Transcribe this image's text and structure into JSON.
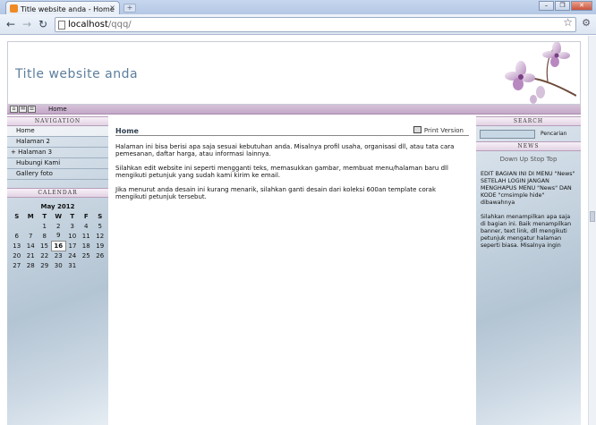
{
  "browser": {
    "tab_title": "Title website anda - Home",
    "tab_close": "×",
    "new_tab": "+",
    "url_host": "localhost",
    "url_path": "/qqq/",
    "icons": [
      "back-icon",
      "forward-icon",
      "reload-icon",
      "star-icon",
      "wrench-icon"
    ]
  },
  "site": {
    "title": "Title website anda",
    "breadcrumb": "Home"
  },
  "navigation": {
    "heading": "NAVIGATION",
    "items": [
      {
        "label": "Home"
      },
      {
        "label": "Halaman 2"
      },
      {
        "label": "+ Halaman 3"
      },
      {
        "label": "Hubungi Kami"
      },
      {
        "label": "Gallery foto"
      }
    ]
  },
  "calendar": {
    "heading": "CALENDAR",
    "month": "May 2012",
    "weekdays": [
      "S",
      "M",
      "T",
      "W",
      "T",
      "F",
      "S"
    ],
    "weeks": [
      [
        "",
        "",
        "1",
        "2",
        "3",
        "4",
        "5"
      ],
      [
        "6",
        "7",
        "8",
        "9",
        "10",
        "11",
        "12"
      ],
      [
        "13",
        "14",
        "15",
        "16",
        "17",
        "18",
        "19"
      ],
      [
        "20",
        "21",
        "22",
        "23",
        "24",
        "25",
        "26"
      ],
      [
        "27",
        "28",
        "29",
        "30",
        "31",
        "",
        ""
      ]
    ],
    "today": "16"
  },
  "main": {
    "title": "Home",
    "print_label": "Print Version",
    "paragraphs": [
      "Halaman ini bisa berisi apa saja sesuai kebutuhan anda. Misalnya profil usaha, organisasi dll, atau tata cara pemesanan, daftar harga, atau informasi lainnya.",
      "Silahkan edit website ini seperti mengganti teks, memasukkan gambar, membuat menu/halaman baru dll mengikuti petunjuk yang sudah kami kirim ke email.",
      "Jika menurut anda desain ini kurang menarik, silahkan ganti desain dari koleksi 600an template corak mengikuti petunjuk tersebut."
    ]
  },
  "search": {
    "heading": "SEARCH",
    "button": "Pencarian",
    "placeholder": ""
  },
  "news": {
    "heading": "NEWS",
    "ticker": "Down Up Stop Top",
    "paragraphs": [
      "EDIT BAGIAN INI DI MENU \"News\" SETELAH LOGIN JANGAN MENGHAPUS MENU \"News\" DAN KODE \"cmsimple hide\" dibawahnya",
      "Silahkan menampilkan apa saja di bagian ini. Baik menampilkan banner, text link, dll mengikuti petunjuk mengatur halaman seperti biasa. Misalnya ingin"
    ]
  }
}
